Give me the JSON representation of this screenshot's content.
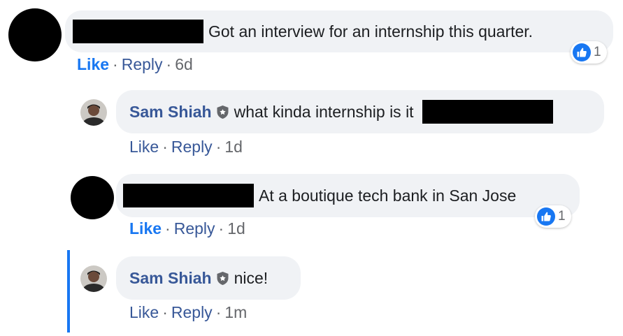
{
  "comments": [
    {
      "text": "Got an interview for an internship this quarter.",
      "reactions": {
        "count": "1"
      },
      "actions": {
        "like": "Like",
        "reply": "Reply",
        "time": "6d"
      }
    },
    {
      "author": "Sam Shiah",
      "text": "what kinda internship is it",
      "actions": {
        "like": "Like",
        "reply": "Reply",
        "time": "1d"
      }
    },
    {
      "text": "At a boutique tech bank in San Jose",
      "reactions": {
        "count": "1"
      },
      "actions": {
        "like": "Like",
        "reply": "Reply",
        "time": "1d"
      }
    },
    {
      "author": "Sam Shiah",
      "text": "nice!",
      "actions": {
        "like": "Like",
        "reply": "Reply",
        "time": "1m"
      }
    }
  ],
  "meta_separator": "·",
  "colors": {
    "author": "#385898",
    "liked": "#1877f2",
    "bubble": "#f0f2f5",
    "meta": "#65676b",
    "thread_line": "#1877f2"
  },
  "icons": {
    "like_reaction": "thumbs-up-icon",
    "author_badge": "shield-badge-icon"
  }
}
